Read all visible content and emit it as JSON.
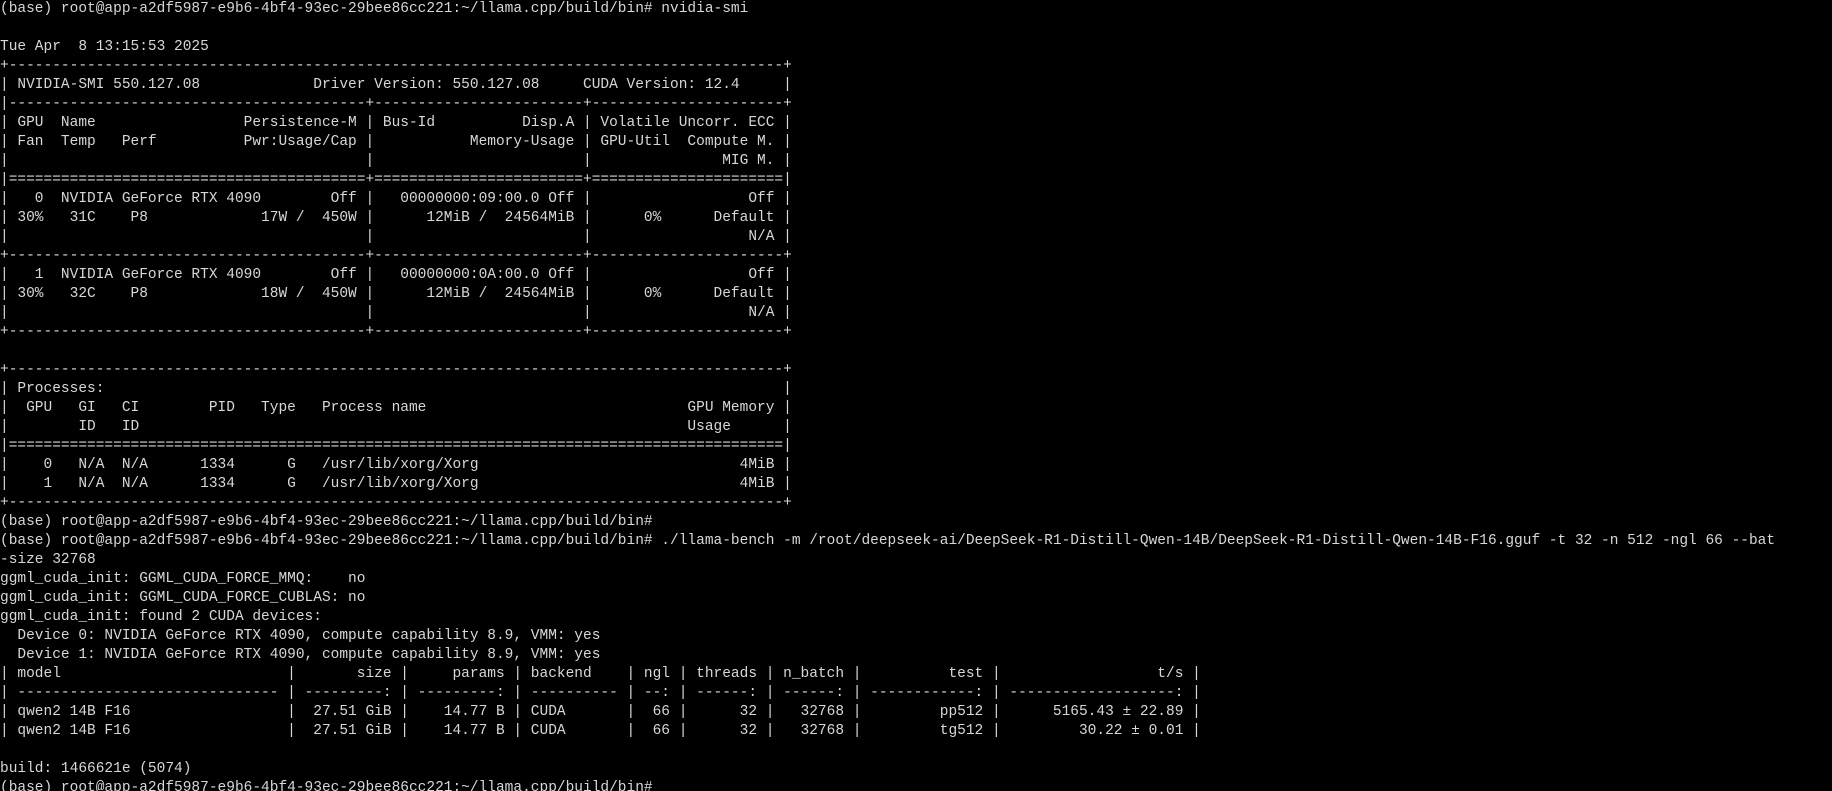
{
  "window": {
    "background": "#000000",
    "foreground": "#d7d7d7"
  },
  "terminal": {
    "lines": [
      "(base) root@app-a2df5987-e9b6-4bf4-93ec-29bee86cc221:~/llama.cpp/build/bin# nvidia-smi",
      "",
      "Tue Apr  8 13:15:53 2025",
      "+-----------------------------------------------------------------------------------------+",
      "| NVIDIA-SMI 550.127.08             Driver Version: 550.127.08     CUDA Version: 12.4     |",
      "|-----------------------------------------+------------------------+----------------------+",
      "| GPU  Name                 Persistence-M | Bus-Id          Disp.A | Volatile Uncorr. ECC |",
      "| Fan  Temp   Perf          Pwr:Usage/Cap |           Memory-Usage | GPU-Util  Compute M. |",
      "|                                         |                        |               MIG M. |",
      "|=========================================+========================+======================|",
      "|   0  NVIDIA GeForce RTX 4090        Off |   00000000:09:00.0 Off |                  Off |",
      "| 30%   31C    P8             17W /  450W |      12MiB /  24564MiB |      0%      Default |",
      "|                                         |                        |                  N/A |",
      "+-----------------------------------------+------------------------+----------------------+",
      "|   1  NVIDIA GeForce RTX 4090        Off |   00000000:0A:00.0 Off |                  Off |",
      "| 30%   32C    P8             18W /  450W |      12MiB /  24564MiB |      0%      Default |",
      "|                                         |                        |                  N/A |",
      "+-----------------------------------------+------------------------+----------------------+",
      "",
      "+-----------------------------------------------------------------------------------------+",
      "| Processes:                                                                              |",
      "|  GPU   GI   CI        PID   Type   Process name                              GPU Memory |",
      "|        ID   ID                                                               Usage      |",
      "|=========================================================================================|",
      "|    0   N/A  N/A      1334      G   /usr/lib/xorg/Xorg                              4MiB |",
      "|    1   N/A  N/A      1334      G   /usr/lib/xorg/Xorg                              4MiB |",
      "+-----------------------------------------------------------------------------------------+",
      "(base) root@app-a2df5987-e9b6-4bf4-93ec-29bee86cc221:~/llama.cpp/build/bin#",
      "(base) root@app-a2df5987-e9b6-4bf4-93ec-29bee86cc221:~/llama.cpp/build/bin# ./llama-bench -m /root/deepseek-ai/DeepSeek-R1-Distill-Qwen-14B/DeepSeek-R1-Distill-Qwen-14B-F16.gguf -t 32 -n 512 -ngl 66 --bat",
      "-size 32768",
      "ggml_cuda_init: GGML_CUDA_FORCE_MMQ:    no",
      "ggml_cuda_init: GGML_CUDA_FORCE_CUBLAS: no",
      "ggml_cuda_init: found 2 CUDA devices:",
      "  Device 0: NVIDIA GeForce RTX 4090, compute capability 8.9, VMM: yes",
      "  Device 1: NVIDIA GeForce RTX 4090, compute capability 8.9, VMM: yes",
      "| model                          |       size |     params | backend    | ngl | threads | n_batch |          test |                  t/s |",
      "| ------------------------------ | ---------: | ---------: | ---------- | --: | ------: | ------: | ------------: | -------------------: |",
      "| qwen2 14B F16                  |  27.51 GiB |    14.77 B | CUDA       |  66 |      32 |   32768 |         pp512 |      5165.43 ± 22.89 |",
      "| qwen2 14B F16                  |  27.51 GiB |    14.77 B | CUDA       |  66 |      32 |   32768 |         tg512 |         30.22 ± 0.01 |",
      "",
      "build: 1466621e (5074)",
      "(base) root@app-a2df5987-e9b6-4bf4-93ec-29bee86cc221:~/llama.cpp/build/bin#"
    ]
  }
}
